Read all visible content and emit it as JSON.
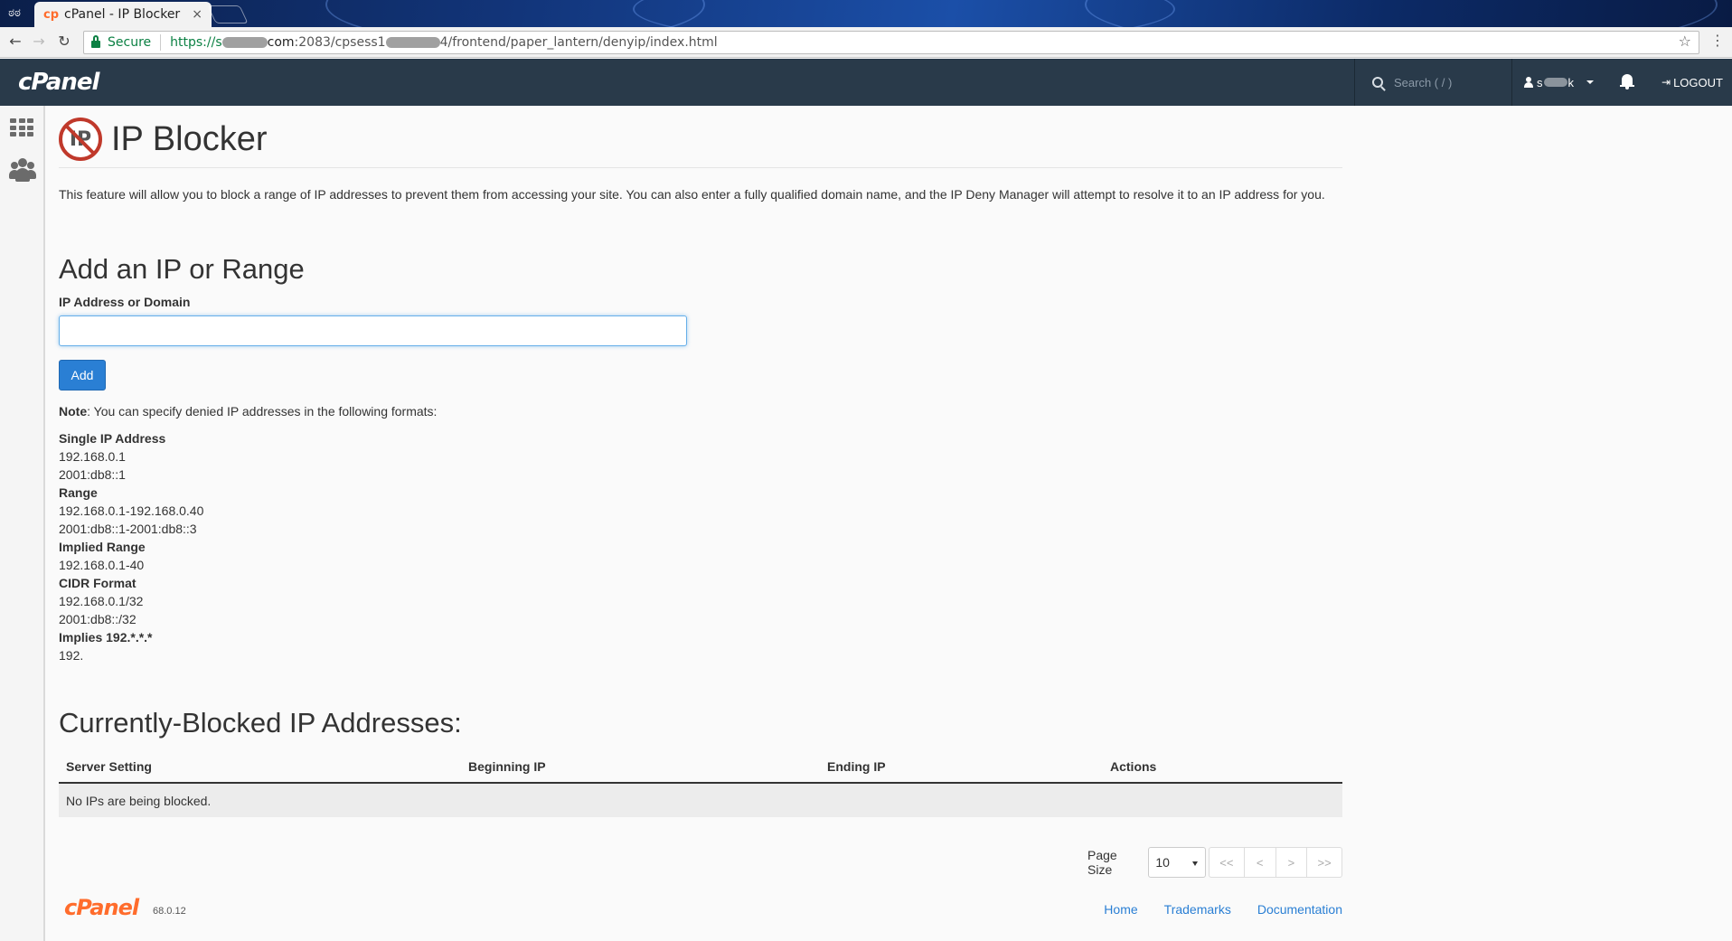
{
  "browser": {
    "tab_title": "cPanel - IP Blocker",
    "tab_close": "×",
    "favicon": "cp",
    "secure_label": "Secure",
    "url_prefix": "https://s",
    "url_part2": "com",
    "url_part3": ":2083/cpsess1",
    "url_part4": "4/frontend/paper_lantern/denyip/index.html"
  },
  "header": {
    "logo": "cPanel",
    "search_placeholder": "Search ( / )",
    "user_prefix": "s",
    "user_suffix": "k",
    "logout_label": "LOGOUT"
  },
  "page": {
    "title": "IP Blocker",
    "icon_text": "IP",
    "description": "This feature will allow you to block a range of IP addresses to prevent them from accessing your site. You can also enter a fully qualified domain name, and the IP Deny Manager will attempt to resolve it to an IP address for you.",
    "add_heading": "Add an IP or Range",
    "field_label": "IP Address or Domain",
    "field_value": "",
    "add_button": "Add",
    "note_bold": "Note",
    "note_text": ": You can specify denied IP addresses in the following formats:",
    "formats": [
      {
        "heading": "Single IP Address",
        "examples": [
          "192.168.0.1",
          "2001:db8::1"
        ]
      },
      {
        "heading": "Range",
        "examples": [
          "192.168.0.1-192.168.0.40",
          "2001:db8::1-2001:db8::3"
        ]
      },
      {
        "heading": "Implied Range",
        "examples": [
          "192.168.0.1-40"
        ]
      },
      {
        "heading": "CIDR Format",
        "examples": [
          "192.168.0.1/32",
          "2001:db8::/32"
        ]
      },
      {
        "heading": "Implies 192.*.*.*",
        "examples": [
          "192."
        ]
      }
    ],
    "blocked_heading": "Currently-Blocked IP Addresses:",
    "table": {
      "columns": [
        "Server Setting",
        "Beginning IP",
        "Ending IP",
        "Actions"
      ],
      "empty_message": "No IPs are being blocked."
    },
    "pager": {
      "page_size_label": "Page Size",
      "page_size_value": "10",
      "first": "<<",
      "prev": "<",
      "next": ">",
      "last": ">>"
    }
  },
  "footer": {
    "logo": "cPanel",
    "version": "68.0.12",
    "links": [
      "Home",
      "Trademarks",
      "Documentation"
    ]
  },
  "colors": {
    "header_bg": "#293a4a",
    "accent_blue": "#2a7fd4",
    "brand_orange": "#ff6c2c",
    "secure_green": "#0b8043"
  }
}
